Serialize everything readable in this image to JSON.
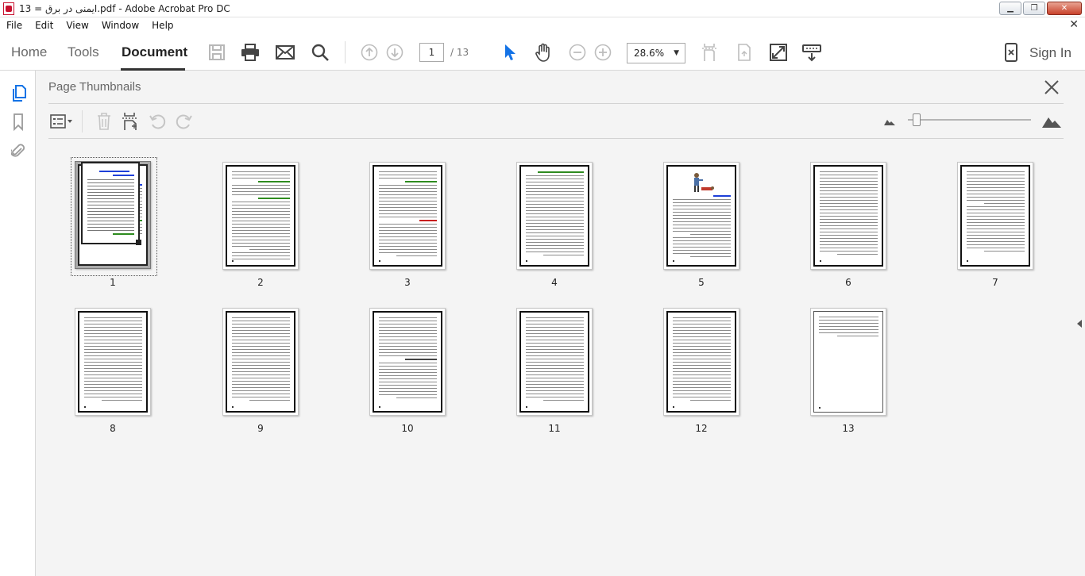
{
  "window": {
    "title": "13 = ایمنی در برق.pdf - Adobe Acrobat Pro DC",
    "min_label": "▁",
    "max_label": "❐",
    "close_label": "✕"
  },
  "menu": {
    "items": [
      "File",
      "Edit",
      "View",
      "Window",
      "Help"
    ],
    "close_glyph": "✕"
  },
  "toolbar": {
    "tabs": {
      "home": "Home",
      "tools": "Tools",
      "document": "Document"
    },
    "page_current": "1",
    "page_total": "/ 13",
    "zoom": "28.6%",
    "sign_in": "Sign In"
  },
  "panel": {
    "title": "Page Thumbnails"
  },
  "thumbnails": {
    "labels": [
      "1",
      "2",
      "3",
      "4",
      "5",
      "6",
      "7",
      "8",
      "9",
      "10",
      "11",
      "12",
      "13"
    ],
    "selected_page": 1
  },
  "colors": {
    "accent_blue": "#1473e6",
    "heading_green": "#2e8b1f",
    "heading_blue": "#1e3fd8"
  }
}
